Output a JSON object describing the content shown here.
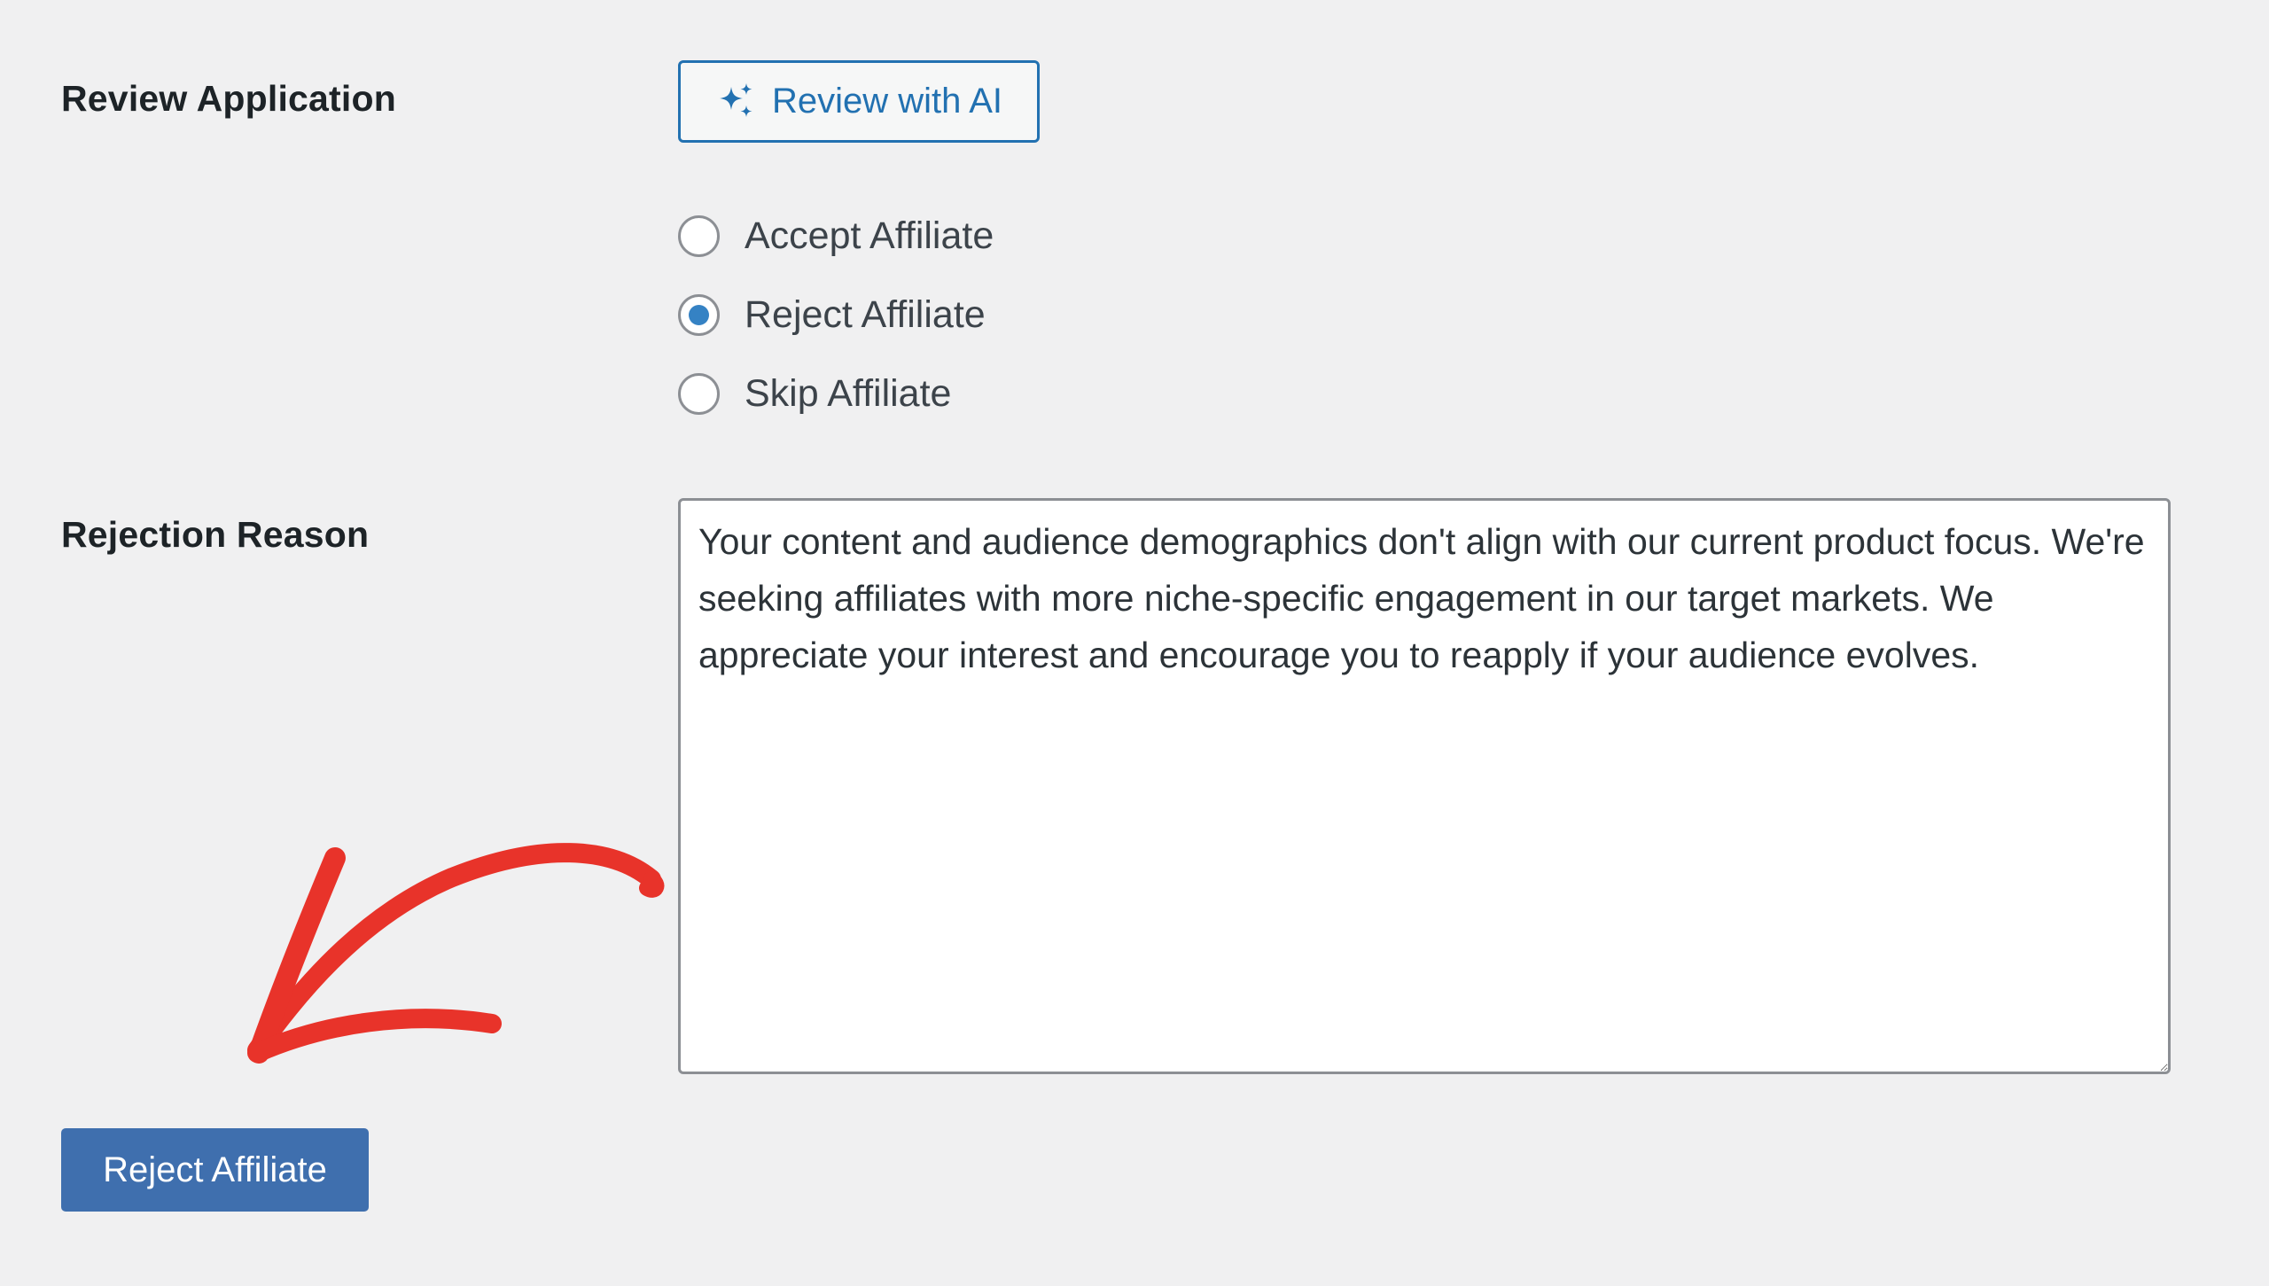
{
  "review": {
    "label": "Review Application",
    "ai_button_label": "Review with AI",
    "ai_button_icon": "sparkles-icon"
  },
  "options": [
    {
      "label": "Accept Affiliate",
      "checked": false
    },
    {
      "label": "Reject Affiliate",
      "checked": true
    },
    {
      "label": "Skip Affiliate",
      "checked": false
    }
  ],
  "rejection": {
    "label": "Rejection Reason",
    "text": "Your content and audience demographics don't align with our current product focus. We're seeking affiliates with more niche-specific engagement in our target markets. We appreciate your interest and encourage you to reapply if your audience evolves."
  },
  "submit": {
    "label": "Reject Affiliate"
  },
  "colors": {
    "accent": "#2271b1",
    "primary_button": "#3f6fae",
    "radio_checked": "#3582c4",
    "annotation_arrow": "#e8332a",
    "background": "#f0f0f1"
  }
}
